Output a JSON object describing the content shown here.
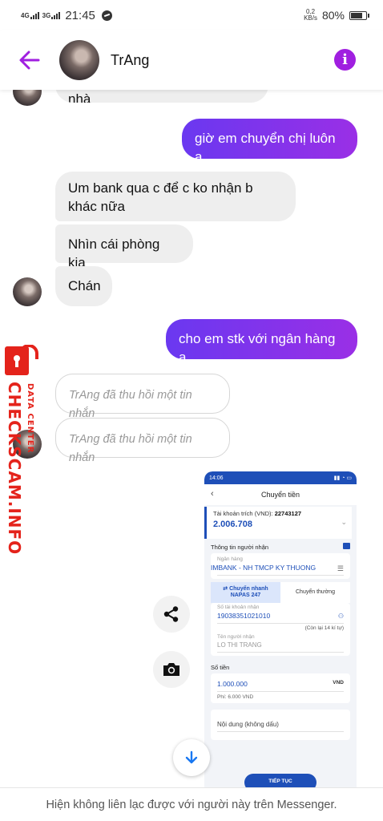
{
  "status_bar": {
    "net1": "4G",
    "net2": "3G",
    "time": "21:45",
    "speed_value": "0,2",
    "speed_unit": "KB/s",
    "battery": "80%"
  },
  "header": {
    "name": "TrAng",
    "back_icon": "arrow-left-icon",
    "info_icon": "info-icon",
    "info_glyph": "i"
  },
  "messages": {
    "cut_top": "Thế tối sáng đều hết cho ở nhà",
    "m1": "giờ em chuyển chị luôn ạ",
    "m2": "Um bank qua c để c ko nhận b khác nữa",
    "m3": "Nhìn cái phòng kia",
    "m4": "Chán",
    "m5": "cho em stk với ngân hàng ạ",
    "recalled1": "TrAng đã thu hồi một tin nhắn",
    "recalled2": "TrAng đã thu hồi một tin nhắn"
  },
  "watermark": {
    "main": "CHECKSCAM.INFO",
    "sub": "DATA CENTER"
  },
  "bank_screenshot": {
    "time": "14:06",
    "title": "Chuyển tiền",
    "account_label": "Tài khoản trích (VND):",
    "account_number": "22743127",
    "balance": "2.006.708",
    "receiver_section": "Thông tin người nhận",
    "bank_label": "Ngân hàng",
    "bank_value": "IMBANK - NH TMCP KY THUONG",
    "tab_fast_1": "Chuyển nhanh",
    "tab_fast_2": "NAPAS 247",
    "tab_normal": "Chuyển thường",
    "account_no_label": "Số tài khoản nhận",
    "account_no_value": "19038351021010",
    "remaining": "(Còn lại 14 kí tự)",
    "receiver_name_label": "Tên người nhận",
    "receiver_name_value": "LO THI TRANG",
    "amount_section": "Số tiền",
    "amount_value": "1.000.000",
    "currency": "VND",
    "fee": "Phí: 6.000 VND",
    "content_placeholder": "Nội dung (không dấu)",
    "continue_button": "TIẾP TỤC"
  },
  "actions": {
    "share_icon": "share-icon",
    "camera_icon": "camera-icon",
    "scroll_icon": "arrow-down-icon"
  },
  "footer": {
    "text": "Hiện không liên lạc được với người này trên Messenger."
  },
  "colors": {
    "accent": "#a01fe0",
    "bubble_gradient_start": "#6a38f0",
    "bubble_gradient_end": "#9a2fe6",
    "incoming_bubble": "#eeeeee",
    "watermark_red": "#e4231b",
    "bank_blue": "#1e4fb8"
  }
}
